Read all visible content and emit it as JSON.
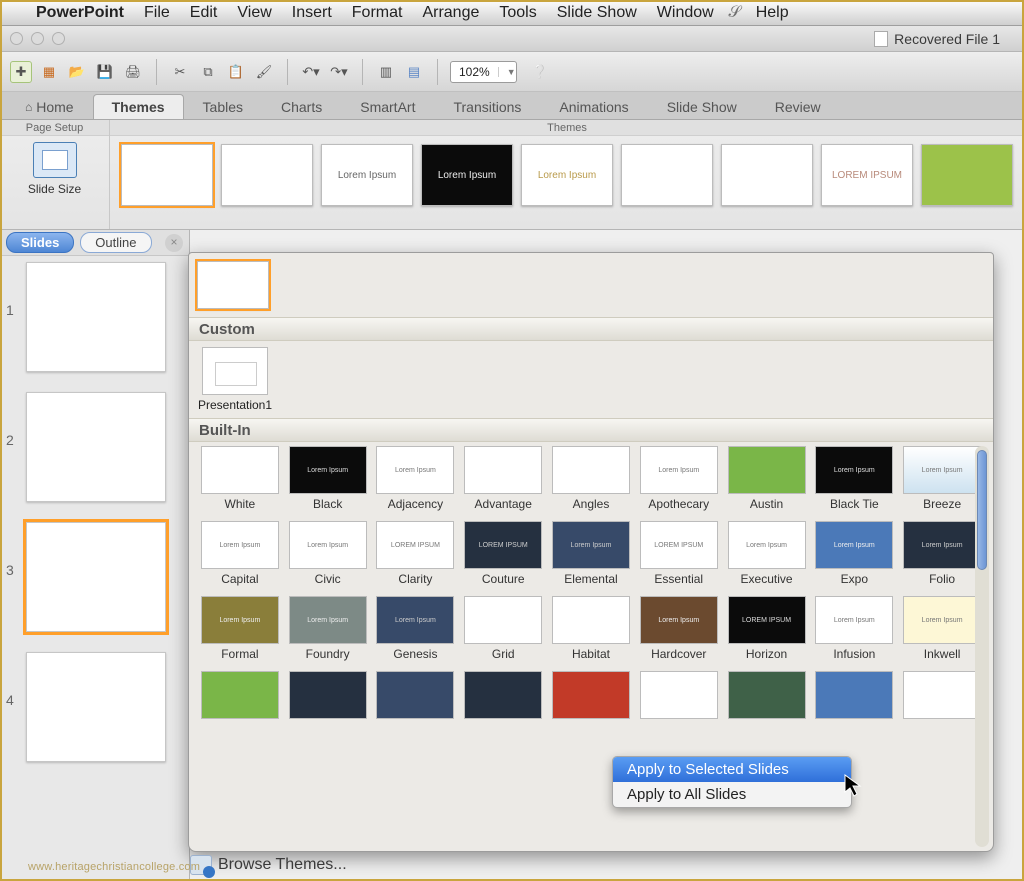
{
  "menubar": {
    "app": "PowerPoint",
    "items": [
      "File",
      "Edit",
      "View",
      "Insert",
      "Format",
      "Arrange",
      "Tools",
      "Slide Show",
      "Window"
    ],
    "help": "Help"
  },
  "window": {
    "title": "Recovered File 1"
  },
  "toolbar": {
    "zoom": "102%"
  },
  "ribbon": {
    "tabs": [
      "Home",
      "Themes",
      "Tables",
      "Charts",
      "SmartArt",
      "Transitions",
      "Animations",
      "Slide Show",
      "Review"
    ],
    "active": "Themes",
    "pagesetup_label": "Page Setup",
    "slidesize_label": "Slide Size",
    "themes_label": "Themes"
  },
  "thumb_tabs": {
    "slides": "Slides",
    "outline": "Outline"
  },
  "slides": [
    1,
    2,
    3,
    4
  ],
  "selected_slide_index": 2,
  "drop": {
    "custom_header": "Custom",
    "builtin_header": "Built-In",
    "custom": [
      {
        "name": "Presentation1"
      }
    ],
    "builtin": [
      {
        "name": "White",
        "cls": ""
      },
      {
        "name": "Black",
        "cls": "black",
        "txt": "Lorem Ipsum"
      },
      {
        "name": "Adjacency",
        "cls": "",
        "txt": "Lorem Ipsum"
      },
      {
        "name": "Advantage",
        "cls": "adv"
      },
      {
        "name": "Angles",
        "cls": "angles"
      },
      {
        "name": "Apothecary",
        "cls": "",
        "txt": "Lorem Ipsum"
      },
      {
        "name": "Austin",
        "cls": "green"
      },
      {
        "name": "Black Tie",
        "cls": "black",
        "txt": "Lorem Ipsum"
      },
      {
        "name": "Breeze",
        "cls": "grad",
        "txt": "Lorem Ipsum"
      },
      {
        "name": "Capital",
        "cls": "",
        "txt": "Lorem Ipsum"
      },
      {
        "name": "Civic",
        "cls": "",
        "txt": "Lorem Ipsum"
      },
      {
        "name": "Clarity",
        "cls": "",
        "txt": "LOREM IPSUM"
      },
      {
        "name": "Couture",
        "cls": "dark",
        "txt": "LOREM IPSUM"
      },
      {
        "name": "Elemental",
        "cls": "navy",
        "txt": "Lorem Ipsum"
      },
      {
        "name": "Essential",
        "cls": "",
        "txt": "LOREM IPSUM"
      },
      {
        "name": "Executive",
        "cls": "",
        "txt": "Lorem Ipsum"
      },
      {
        "name": "Expo",
        "cls": "blue",
        "txt": "Lorem Ipsum"
      },
      {
        "name": "Folio",
        "cls": "dark",
        "txt": "Lorem Ipsum"
      },
      {
        "name": "Formal",
        "cls": "olive",
        "txt": "Lorem Ipsum"
      },
      {
        "name": "Foundry",
        "cls": "foundry",
        "txt": "Lorem Ipsum"
      },
      {
        "name": "Genesis",
        "cls": "navy",
        "txt": "Lorem Ipsum"
      },
      {
        "name": "Grid",
        "cls": "grid4"
      },
      {
        "name": "Habitat",
        "cls": "habitat"
      },
      {
        "name": "Hardcover",
        "cls": "brown",
        "txt": "Lorem Ipsum"
      },
      {
        "name": "Horizon",
        "cls": "black",
        "txt": "LOREM IPSUM"
      },
      {
        "name": "Infusion",
        "cls": "",
        "txt": "Lorem Ipsum"
      },
      {
        "name": "Inkwell",
        "cls": "cream",
        "txt": "Lorem Ipsum"
      },
      {
        "name": "",
        "cls": "green"
      },
      {
        "name": "",
        "cls": "dark"
      },
      {
        "name": "",
        "cls": "navy"
      },
      {
        "name": "",
        "cls": "dark"
      },
      {
        "name": "",
        "cls": "red"
      },
      {
        "name": "",
        "cls": ""
      },
      {
        "name": "",
        "cls": "teal"
      },
      {
        "name": "",
        "cls": "blue"
      },
      {
        "name": "",
        "cls": ""
      }
    ]
  },
  "context_menu": {
    "items": [
      "Apply to Selected Slides",
      "Apply to All Slides"
    ],
    "selected": 0
  },
  "footer": {
    "browse": "Browse Themes..."
  },
  "watermark": "www.heritagechristiancollege.com"
}
